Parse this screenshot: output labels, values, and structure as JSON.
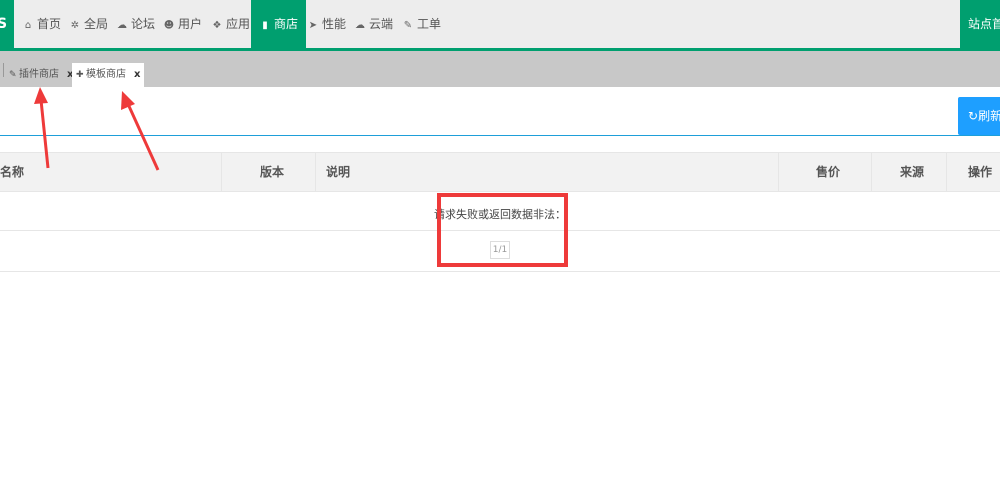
{
  "nav": {
    "brand_letter": "S",
    "items": [
      {
        "label": "首页",
        "icon": "home-icon",
        "glyph": "⌂"
      },
      {
        "label": "全局",
        "icon": "cogs-icon",
        "glyph": "✲"
      },
      {
        "label": "论坛",
        "icon": "comments-icon",
        "glyph": "☁"
      },
      {
        "label": "用户",
        "icon": "users-icon",
        "glyph": "☻"
      },
      {
        "label": "应用",
        "icon": "cubes-icon",
        "glyph": "❖"
      },
      {
        "label": "商店",
        "icon": "shopping-bag-icon",
        "glyph": "▮"
      },
      {
        "label": "性能",
        "icon": "paper-plane-icon",
        "glyph": "➤"
      },
      {
        "label": "云端",
        "icon": "cloud-icon",
        "glyph": "☁"
      },
      {
        "label": "工单",
        "icon": "wrench-icon",
        "glyph": "✎"
      }
    ],
    "active": "商店",
    "site_home": "站点首页"
  },
  "tabs": [
    {
      "label": "插件商店",
      "icon": "plug-icon",
      "glyph": "✎",
      "close": "x"
    },
    {
      "label": "模板商店",
      "icon": "puzzle-icon",
      "glyph": "✚",
      "close": "x"
    }
  ],
  "toolbar": {
    "refresh_label": "刷新",
    "refresh_glyph": "↻"
  },
  "table": {
    "columns": [
      "名称",
      "版本",
      "说明",
      "售价",
      "来源",
      "操作"
    ],
    "message": "请求失败或返回数据非法：",
    "pager": "1/1"
  },
  "colors": {
    "accent": "#009f6f",
    "refresh": "#1e9fff",
    "annotation": "#ee3a3a"
  }
}
